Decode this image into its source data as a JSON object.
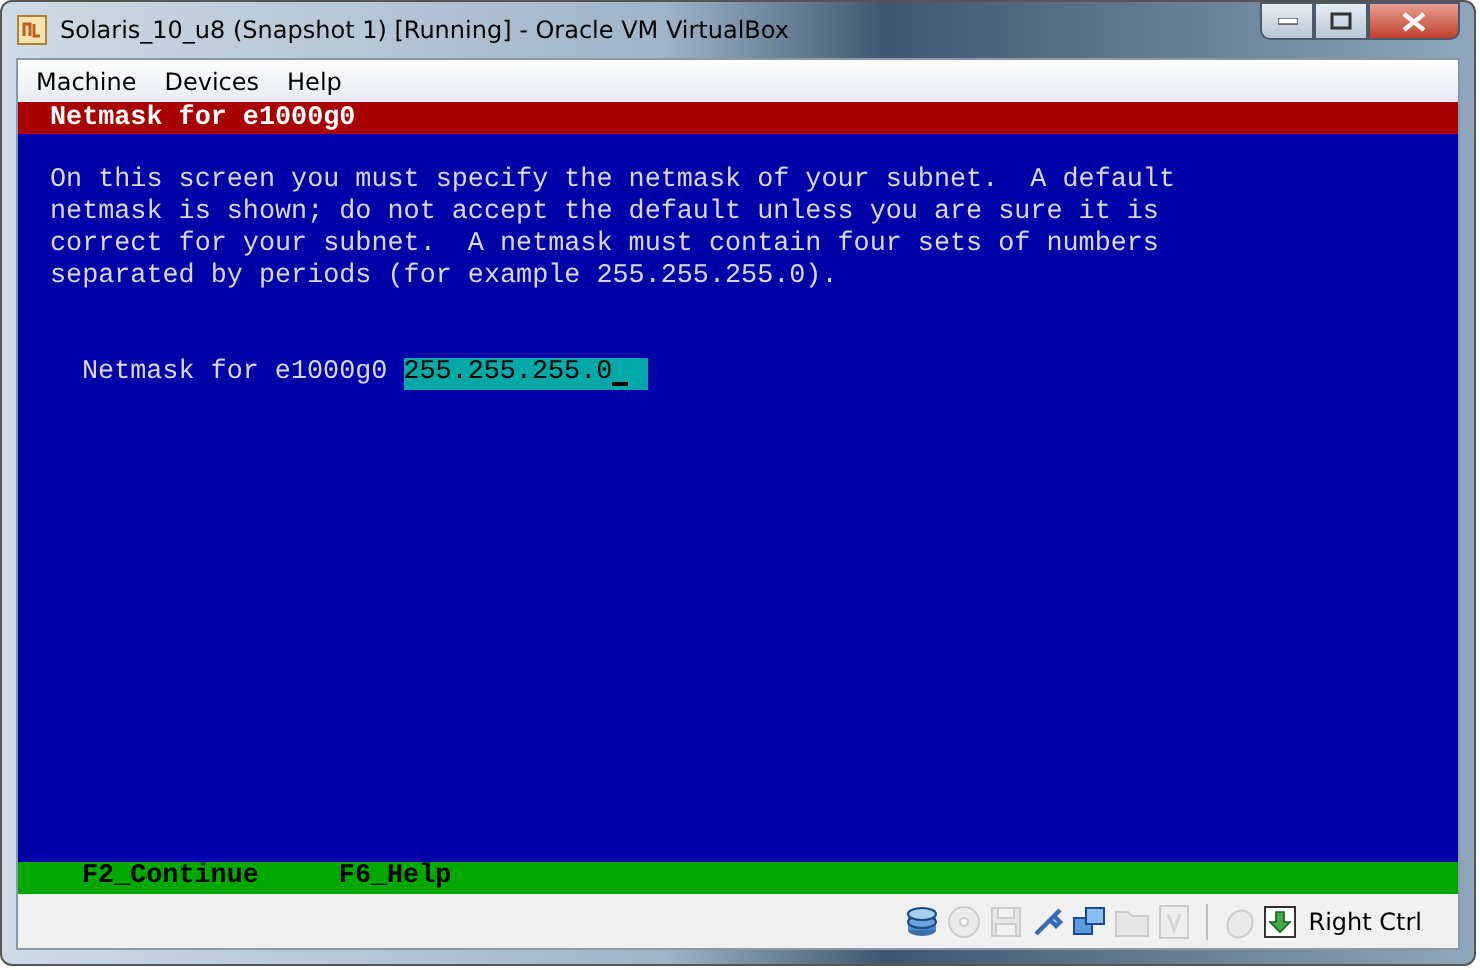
{
  "window": {
    "title": "Solaris_10_u8 (Snapshot 1) [Running] - Oracle VM VirtualBox"
  },
  "menu": [
    "Machine",
    "Devices",
    "Help"
  ],
  "console": {
    "header": "Netmask for e1000g0",
    "lines": [
      "On this screen you must specify the netmask of your subnet.  A default",
      "netmask is shown; do not accept the default unless you are sure it is",
      "correct for your subnet.  A netmask must contain four sets of numbers",
      "separated by periods (for example 255.255.255.0)."
    ],
    "field": {
      "label": "Netmask for e1000g0",
      "value": "255.255.255.0"
    },
    "footer": [
      "F2_Continue",
      "F6_Help"
    ]
  },
  "status_bar": {
    "icons": [
      {
        "kind": "disk",
        "disabled": false
      },
      {
        "kind": "cd",
        "disabled": true
      },
      {
        "kind": "floppy",
        "disabled": true
      },
      {
        "kind": "usb",
        "disabled": false
      },
      {
        "kind": "network",
        "disabled": false
      },
      {
        "kind": "folder",
        "disabled": true
      },
      {
        "kind": "vrdp",
        "disabled": true
      },
      {
        "kind": "mouse",
        "disabled": true
      }
    ],
    "host_key": "Right Ctrl"
  }
}
